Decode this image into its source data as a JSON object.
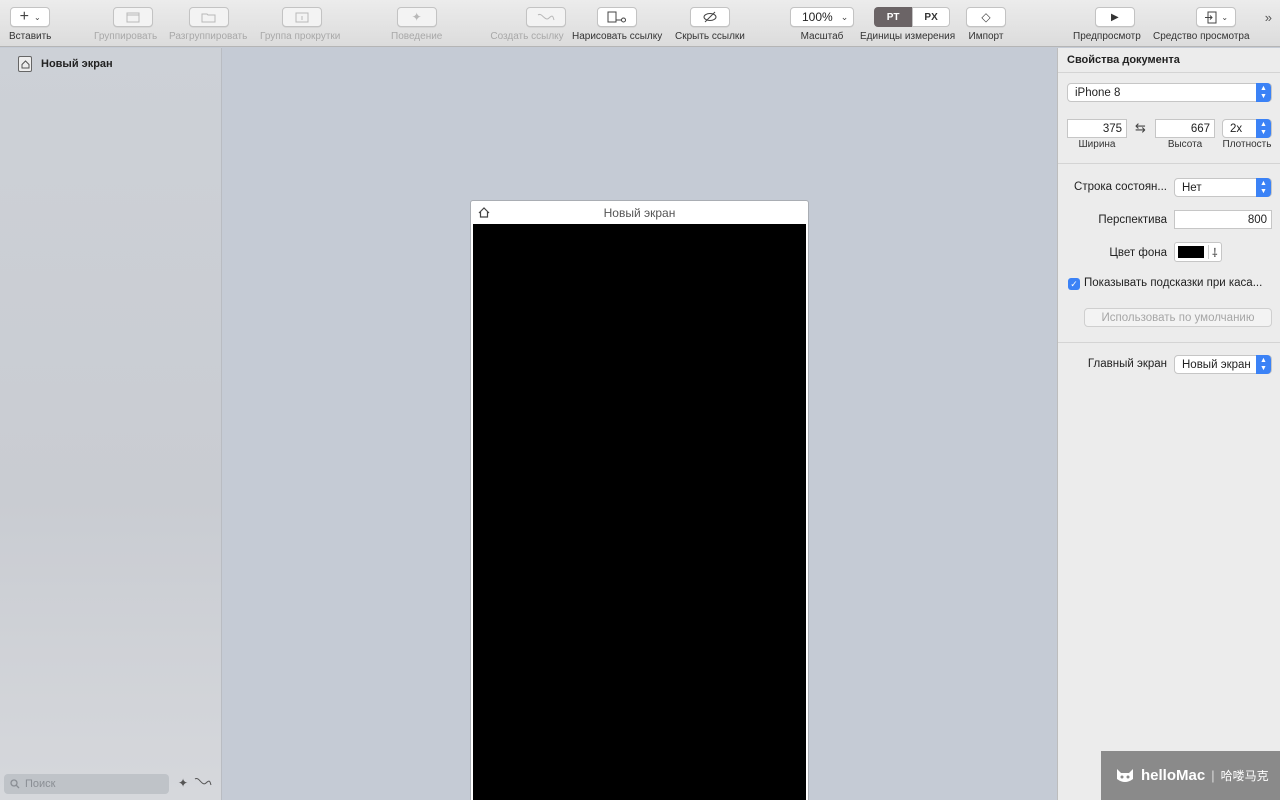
{
  "toolbar": {
    "insert": "Вставить",
    "group": "Группировать",
    "ungroup": "Разгруппировать",
    "scroll_group": "Группа прокрутки",
    "behavior": "Поведение",
    "create_link": "Создать ссылку",
    "draw_link": "Нарисовать ссылку",
    "hide_links": "Скрыть ссылки",
    "zoom_value": "100%",
    "zoom_label": "Масштаб",
    "units_pt": "PT",
    "units_px": "PX",
    "units_label": "Единицы измерения",
    "import": "Импорт",
    "preview": "Предпросмотр",
    "viewer": "Средство просмотра"
  },
  "sidebar": {
    "screen_name": "Новый экран",
    "search_placeholder": "Поиск"
  },
  "canvas": {
    "screen_title": "Новый экран"
  },
  "panel": {
    "title": "Свойства документа",
    "device": "iPhone 8",
    "width": "375",
    "width_label": "Ширина",
    "height": "667",
    "height_label": "Высота",
    "density": "2x",
    "density_label": "Плотность",
    "status_bar_label": "Строка состоян...",
    "status_bar_value": "Нет",
    "perspective_label": "Перспектива",
    "perspective_value": "800",
    "bg_color_label": "Цвет фона",
    "bg_color": "#000000",
    "show_hints_label": "Показывать подсказки при каса...",
    "show_hints_checked": true,
    "use_default": "Использовать по умолчанию",
    "main_screen_label": "Главный экран",
    "main_screen_value": "Новый экран"
  },
  "watermark": {
    "brand": "helloMac",
    "cn": "哈喽马克"
  },
  "colors": {
    "accent": "#3b82f6",
    "canvas_bg": "#c5cbd5",
    "units_active": "#6b6466"
  }
}
